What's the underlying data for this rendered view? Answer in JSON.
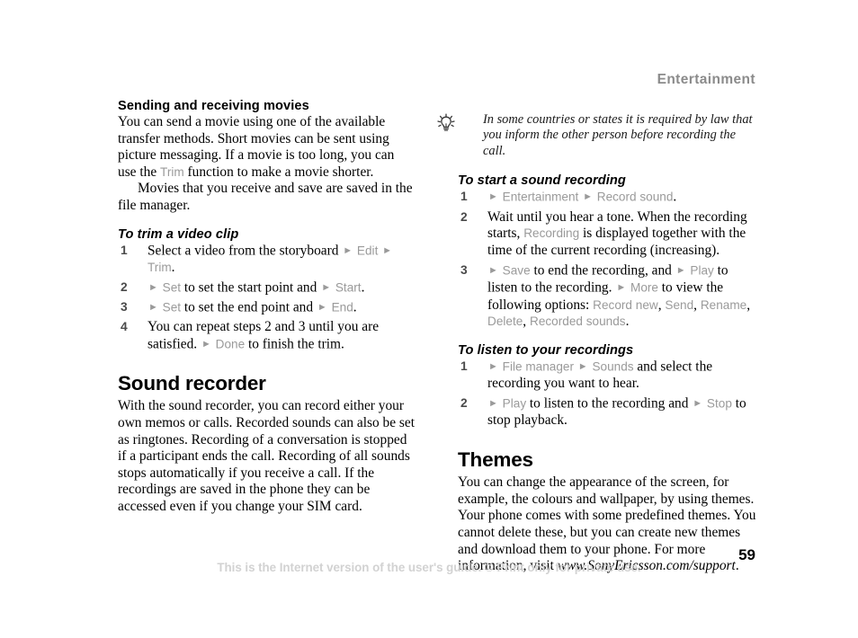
{
  "header": {
    "running_head": "Entertainment"
  },
  "footer": {
    "note": "This is the Internet version of the user's guide. © Print only for private use.",
    "page_number": "59"
  },
  "left_column": {
    "section_movies": {
      "heading": "Sending and receiving movies",
      "para1_a": "You can send a movie using one of the available transfer methods. Short movies can be sent using picture messaging. If a movie is too long, you can use the ",
      "para1_menu": "Trim",
      "para1_b": " function to make a movie shorter.",
      "para2": "Movies that you receive and save are saved in the file manager."
    },
    "task_trim": {
      "heading": "To trim a video clip",
      "steps": [
        {
          "num": "1",
          "parts": [
            {
              "t": "text",
              "v": "Select a video from the storyboard "
            },
            {
              "t": "arrow",
              "v": "►"
            },
            {
              "t": "menu",
              "v": " Edit "
            },
            {
              "t": "arrow",
              "v": "►"
            },
            {
              "t": "menu",
              "v": " Trim"
            },
            {
              "t": "text",
              "v": "."
            }
          ]
        },
        {
          "num": "2",
          "parts": [
            {
              "t": "arrow",
              "v": "►"
            },
            {
              "t": "menu",
              "v": " Set "
            },
            {
              "t": "text",
              "v": "to set the start point and "
            },
            {
              "t": "arrow",
              "v": "►"
            },
            {
              "t": "menu",
              "v": " Start"
            },
            {
              "t": "text",
              "v": "."
            }
          ]
        },
        {
          "num": "3",
          "parts": [
            {
              "t": "arrow",
              "v": "►"
            },
            {
              "t": "menu",
              "v": " Set "
            },
            {
              "t": "text",
              "v": "to set the end point and "
            },
            {
              "t": "arrow",
              "v": "►"
            },
            {
              "t": "menu",
              "v": " End"
            },
            {
              "t": "text",
              "v": "."
            }
          ]
        },
        {
          "num": "4",
          "parts": [
            {
              "t": "text",
              "v": "You can repeat steps 2 and 3 until you are satisfied. "
            },
            {
              "t": "arrow",
              "v": "►"
            },
            {
              "t": "menu",
              "v": " Done "
            },
            {
              "t": "text",
              "v": "to finish the trim."
            }
          ]
        }
      ]
    },
    "section_sound_recorder": {
      "heading": "Sound recorder",
      "para1": "With the sound recorder, you can record either your own memos or calls. Recorded sounds can also be set as ringtones. Recording of a conversation is stopped if a participant ends the call. Recording of all sounds stops automatically if you receive a call. If the recordings are saved in the phone they can be accessed even if you change your SIM card."
    }
  },
  "right_column": {
    "tip": {
      "icon": "lightbulb-tip-icon",
      "text": "In some countries or states it is required by law that you inform the other person before recording the call."
    },
    "task_start_recording": {
      "heading": "To start a sound recording",
      "steps": [
        {
          "num": "1",
          "parts": [
            {
              "t": "arrow",
              "v": "►"
            },
            {
              "t": "menu",
              "v": " Entertainment "
            },
            {
              "t": "arrow",
              "v": "►"
            },
            {
              "t": "menu",
              "v": " Record sound"
            },
            {
              "t": "text",
              "v": "."
            }
          ]
        },
        {
          "num": "2",
          "parts": [
            {
              "t": "text",
              "v": "Wait until you hear a tone. When the recording starts, "
            },
            {
              "t": "menu",
              "v": "Recording"
            },
            {
              "t": "text",
              "v": " is displayed together with the time of the current recording (increasing)."
            }
          ]
        },
        {
          "num": "3",
          "parts": [
            {
              "t": "arrow",
              "v": "►"
            },
            {
              "t": "menu",
              "v": " Save "
            },
            {
              "t": "text",
              "v": "to end the recording, and "
            },
            {
              "t": "arrow",
              "v": "►"
            },
            {
              "t": "menu",
              "v": " Play "
            },
            {
              "t": "text",
              "v": "to listen to the recording. "
            },
            {
              "t": "arrow",
              "v": "►"
            },
            {
              "t": "menu",
              "v": " More "
            },
            {
              "t": "text",
              "v": "to view the following options: "
            },
            {
              "t": "menu",
              "v": "Record new"
            },
            {
              "t": "text",
              "v": ", "
            },
            {
              "t": "menu",
              "v": "Send"
            },
            {
              "t": "text",
              "v": ", "
            },
            {
              "t": "menu",
              "v": "Rename"
            },
            {
              "t": "text",
              "v": ", "
            },
            {
              "t": "menu",
              "v": "Delete"
            },
            {
              "t": "text",
              "v": ", "
            },
            {
              "t": "menu",
              "v": "Recorded sounds"
            },
            {
              "t": "text",
              "v": "."
            }
          ]
        }
      ]
    },
    "task_listen_recordings": {
      "heading": "To listen to your recordings",
      "steps": [
        {
          "num": "1",
          "parts": [
            {
              "t": "arrow",
              "v": "►"
            },
            {
              "t": "menu",
              "v": " File manager "
            },
            {
              "t": "arrow",
              "v": "►"
            },
            {
              "t": "menu",
              "v": " Sounds "
            },
            {
              "t": "text",
              "v": "and select the recording you want to hear."
            }
          ]
        },
        {
          "num": "2",
          "parts": [
            {
              "t": "arrow",
              "v": "►"
            },
            {
              "t": "menu",
              "v": " Play "
            },
            {
              "t": "text",
              "v": "to listen to the recording and "
            },
            {
              "t": "arrow",
              "v": "►"
            },
            {
              "t": "menu",
              "v": " Stop "
            },
            {
              "t": "text",
              "v": "to stop playback."
            }
          ]
        }
      ]
    },
    "section_themes": {
      "heading": "Themes",
      "para1": "You can change the appearance of the screen, for example, the colours and wallpaper, by using themes. Your phone comes with some predefined themes. You cannot delete these, but you can create new themes and download them to your phone. For more information, visit ",
      "url": "www.SonyEricsson.com/support",
      "para1_end": "."
    }
  },
  "colors": {
    "menu_grey": "#9a9a9a",
    "running_head_grey": "#8b8b8b",
    "footer_grey": "#d2d2d2",
    "step_number_grey": "#4a4a4a",
    "body_black": "#000000"
  }
}
